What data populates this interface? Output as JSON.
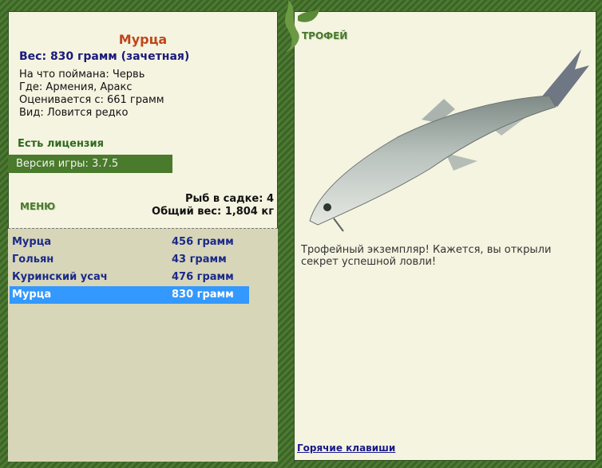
{
  "fish": {
    "name": "Мурца",
    "weight_line": "Вес: 830 грамм (зачетная)",
    "bait": "На что поймана: Червь",
    "location": "Где: Армения, Аракс",
    "min_weight": "Оценивается с: 661 грамм",
    "rarity": "Вид: Ловится редко"
  },
  "license": "Есть лицензия",
  "version": "Версия игры: 3.7.5",
  "menu_label": "МЕНЮ",
  "keepnet": {
    "count": "Рыб в садке: 4",
    "total": "Общий вес: 1,804 кг"
  },
  "catch_list": [
    {
      "name": "Мурца",
      "weight": "456 грамм",
      "selected": false
    },
    {
      "name": "Гольян",
      "weight": "43 грамм",
      "selected": false
    },
    {
      "name": "Куринский усач",
      "weight": "476 грамм",
      "selected": false
    },
    {
      "name": "Мурца",
      "weight": "830 грамм",
      "selected": true
    }
  ],
  "trophy": {
    "label": "ТРОФЕЙ",
    "text": "Трофейный экземпляр! Кажется, вы открыли секрет успешной ловли!"
  },
  "hotkeys": "Горячие клавиши",
  "colors": {
    "frame": "#3f6a2a",
    "panel": "#f5f4e1",
    "accent": "#4a7a2c",
    "selected": "#3399ff"
  }
}
